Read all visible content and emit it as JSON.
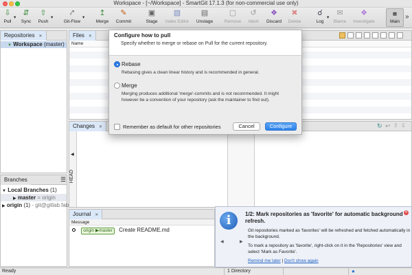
{
  "window": {
    "title": "Workspace - [~/Workspace] - SmartGit 17.1.3 (for non-commercial use only)"
  },
  "toolbar": {
    "pull": "Pull",
    "sync": "Sync",
    "push": "Push",
    "gitflow": "Git-Flow",
    "merge": "Merge",
    "commit": "Commit",
    "stage": "Stage",
    "index_editor": "Index Editor",
    "unstage": "Unstage",
    "remove": "Remove",
    "abort": "Abort",
    "discard": "Discard",
    "delete": "Delete",
    "log": "Log",
    "blame": "Blame",
    "investigate": "Investigate",
    "main": "Main",
    "more": "»"
  },
  "repositories": {
    "tab": "Repositories",
    "row_name": "Workspace",
    "row_branch": "(master)"
  },
  "files": {
    "tab": "Files",
    "col_name": "Name"
  },
  "changes": {
    "tab": "Changes",
    "head_label": "HEAD"
  },
  "branches": {
    "tab": "Branches",
    "local_label": "Local Branches",
    "local_count": "(1)",
    "master": "master",
    "master_tracking": "= origin",
    "origin": "origin",
    "origin_count": "(1)",
    "origin_url": "- git@gitlab.fab"
  },
  "journal": {
    "tab": "Journal",
    "col_message": "Message",
    "tag_origin": "origin",
    "tag_master": "master",
    "message": "Create README.md"
  },
  "dialog": {
    "title": "Configure how to pull",
    "subtitle": "Specify whether to merge or rebase on Pull for the current repository.",
    "rebase_label": "Rebase",
    "rebase_desc": "Rebasing gives a clean linear history and is recommended in general.",
    "merge_label": "Merge",
    "merge_desc": "Merging produces additional 'merge'-commits and is not recommended. It might however be a convention of your repository (ask the maintainer to find out).",
    "remember_label": "Remember as default for other repositories",
    "cancel": "Cancel",
    "configure": "Configure",
    "selected": "rebase"
  },
  "notification": {
    "title": "1/2: Mark repositories as 'favorite' for automatic background refresh.",
    "text1": "Git repositories marked as 'favorites' will be refreshed and fetched automatically in the background.",
    "text2": "To mark a repository as 'favorite', right-click on it in the 'Repositories' view and select 'Mark as Favorite'.",
    "remind_later": "Remind me later",
    "separator": "|",
    "dont_show": "Don't show again"
  },
  "status": {
    "left": "Ready",
    "middle": "1 Directory"
  },
  "colors": {
    "accent": "#2b7de9",
    "selection": "#c8d9ef",
    "close": "#fc605c"
  }
}
